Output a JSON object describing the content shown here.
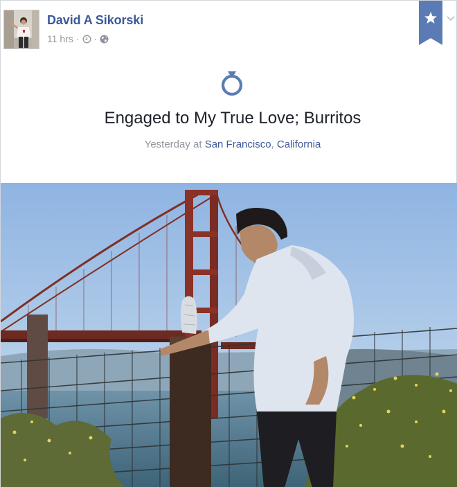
{
  "post": {
    "author_name": "David A Sikorski",
    "timestamp": "11 hrs",
    "separator": "·",
    "clock_icon": "clock-icon",
    "privacy_icon": "globe-icon"
  },
  "life_event": {
    "icon": "ring-icon",
    "title": "Engaged to My True Love; Burritos",
    "when": "Yesterday at",
    "place": "San Francisco",
    "comma": ",",
    "region": "California"
  },
  "controls": {
    "bookmark_icon": "star-icon",
    "menu_icon": "chevron-down-icon"
  },
  "colors": {
    "link": "#3b5998",
    "muted": "#90949c",
    "bookmark": "#5b7bb4",
    "ring": "#5b7bb4"
  }
}
